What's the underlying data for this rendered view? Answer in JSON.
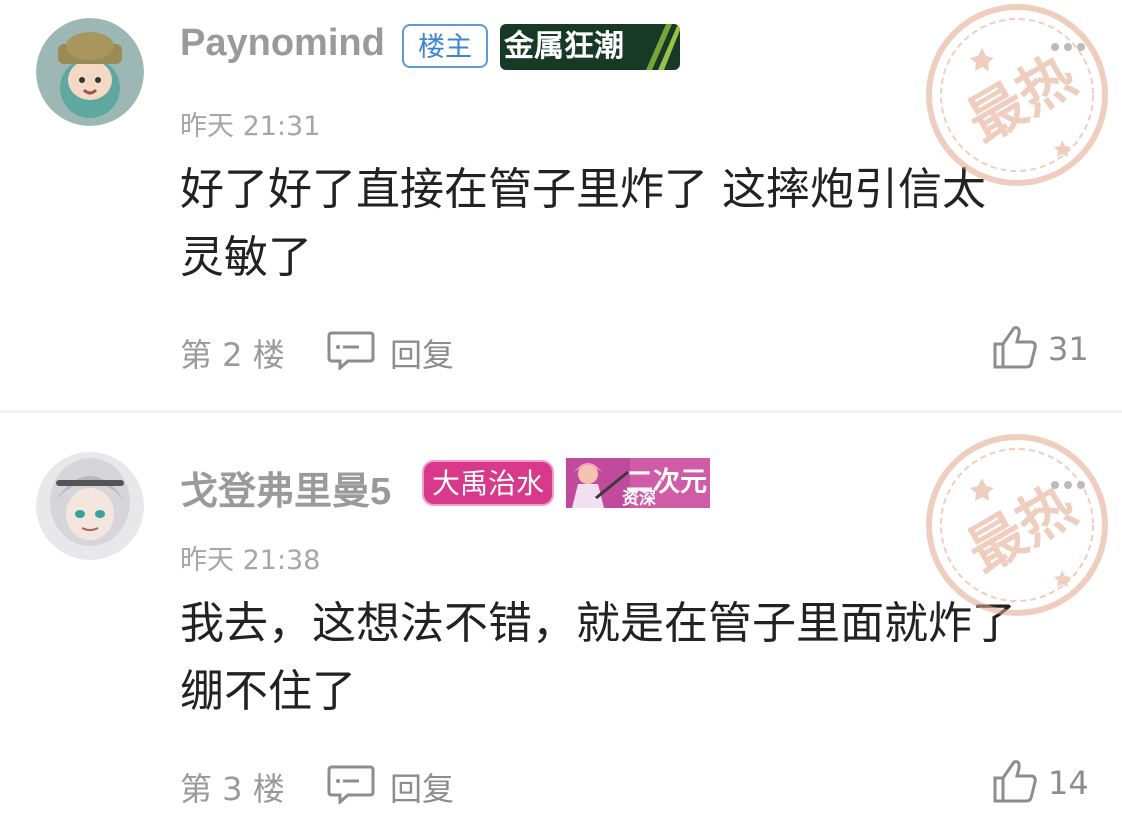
{
  "comments": [
    {
      "username": "Paynomind",
      "badges": {
        "host": "楼主",
        "medal": "金属狂潮"
      },
      "timestamp": "昨天 21:31",
      "content_line1": "好了好了直接在管子里炸了 这摔炮引信太",
      "content_line2": "灵敏了",
      "floor": "第 2 楼",
      "reply_label": "回复",
      "likes": "31",
      "hot_stamp": "最热"
    },
    {
      "username": "戈登弗里曼5",
      "badges": {
        "medal": "大禹治水",
        "acg_line1": "二次元",
        "acg_line2": "资深"
      },
      "timestamp": "昨天 21:38",
      "content_line1": "我去，这想法不错，就是在管子里面就炸了",
      "content_line2": "绷不住了",
      "floor": "第 3 楼",
      "reply_label": "回复",
      "likes": "14",
      "hot_stamp": "最热"
    }
  ],
  "colors": {
    "stamp": "#e3a78c",
    "host_badge": "#3b86d3",
    "medal_green": "#173a26",
    "medal_pink": "#d9398a"
  }
}
